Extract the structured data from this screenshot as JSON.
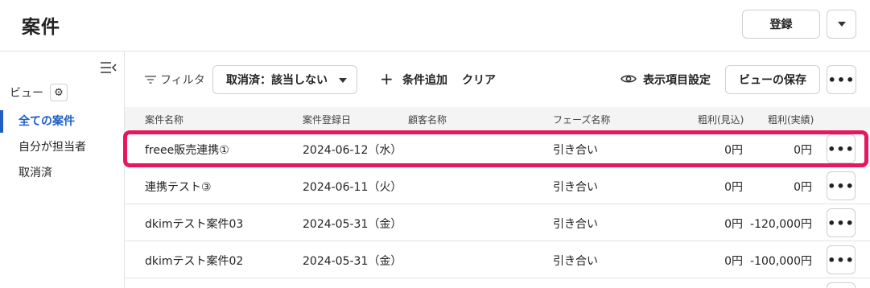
{
  "header": {
    "title": "案件",
    "register_label": "登録"
  },
  "sidebar": {
    "view_label": "ビュー",
    "items": [
      {
        "label": "全ての案件",
        "active": true
      },
      {
        "label": "自分が担当者",
        "active": false
      },
      {
        "label": "取消済",
        "active": false
      }
    ]
  },
  "toolbar": {
    "filter_label": "フィルタ",
    "filter_value": "取消済：該当しない",
    "add_condition_label": "条件追加",
    "clear_label": "クリア",
    "display_settings_label": "表示項目設定",
    "save_view_label": "ビューの保存"
  },
  "table": {
    "columns": [
      "案件名称",
      "案件登録日",
      "顧客名称",
      "フェーズ名称",
      "粗利(見込)",
      "粗利(実績)"
    ],
    "rows": [
      {
        "name": "freee販売連携①",
        "date": "2024-06-12（水）",
        "customer": "",
        "phase": "引き合い",
        "profit_est": "0円",
        "profit_act": "0円",
        "highlighted": true
      },
      {
        "name": "連携テスト③",
        "date": "2024-06-11（火）",
        "customer": "",
        "phase": "引き合い",
        "profit_est": "0円",
        "profit_act": "0円",
        "highlighted": false
      },
      {
        "name": "dkimテスト案件03",
        "date": "2024-05-31（金）",
        "customer": "",
        "phase": "引き合い",
        "profit_est": "0円",
        "profit_act": "-120,000円",
        "highlighted": false
      },
      {
        "name": "dkimテスト案件02",
        "date": "2024-05-31（金）",
        "customer": "",
        "phase": "引き合い",
        "profit_est": "0円",
        "profit_act": "-100,000円",
        "highlighted": false
      }
    ]
  },
  "colors": {
    "accent": "#1f5fc4",
    "highlight": "#e8175d"
  }
}
